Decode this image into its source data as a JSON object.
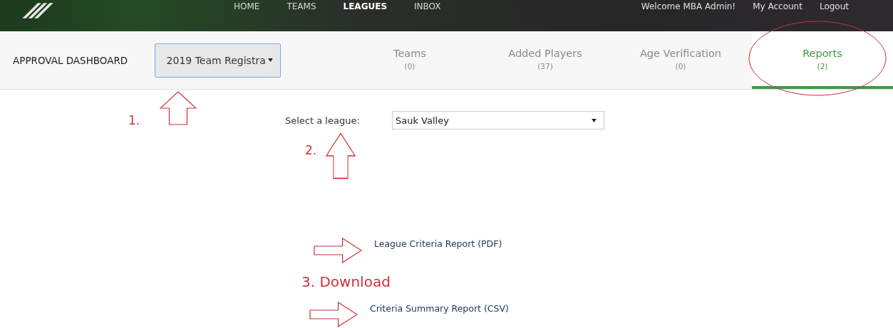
{
  "header": {
    "nav": [
      {
        "label": "HOME",
        "selected": false
      },
      {
        "label": "TEAMS",
        "selected": false
      },
      {
        "label": "LEAGUES",
        "selected": true
      },
      {
        "label": "INBOX",
        "selected": false
      }
    ],
    "user_links": [
      "Welcome MBA Admin!",
      "My Account",
      "Logout"
    ]
  },
  "dashboard": {
    "title": "APPROVAL DASHBOARD",
    "period_select": {
      "value": "2019 Team Registra"
    },
    "tabs": [
      {
        "label": "Teams",
        "count": "(0)",
        "selected": false
      },
      {
        "label": "Added Players",
        "count": "(37)",
        "selected": false
      },
      {
        "label": "Age Verification",
        "count": "(0)",
        "selected": false
      },
      {
        "label": "Reports",
        "count": "(2)",
        "selected": true
      }
    ]
  },
  "league_select": {
    "label": "Select a league:",
    "value": "Sauk Valley"
  },
  "reports": [
    {
      "label": "League Criteria Report (PDF)"
    },
    {
      "label": "Criteria Summary Report (CSV)"
    }
  ],
  "annotations": [
    {
      "kind": "step",
      "text": "1."
    },
    {
      "kind": "step",
      "text": "2."
    },
    {
      "kind": "step",
      "text": "3. Download"
    }
  ]
}
